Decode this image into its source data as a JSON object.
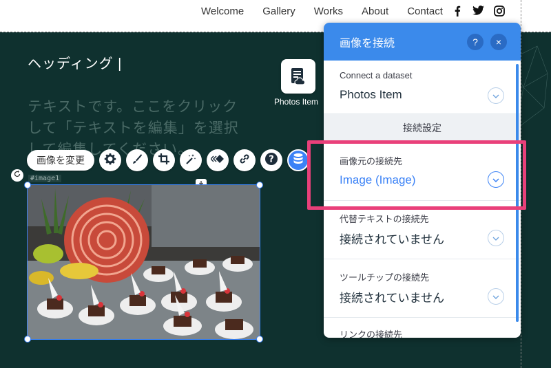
{
  "nav": {
    "links": [
      "Welcome",
      "Gallery",
      "Works",
      "About",
      "Contact"
    ],
    "social": [
      "facebook-icon",
      "twitter-icon",
      "instagram-icon"
    ]
  },
  "canvas": {
    "heading": "ヘッディング |",
    "body_lines": [
      "テキストです。ここをクリック",
      "して「テキストを編集」を選択",
      "して編集してください。"
    ],
    "dataset_label": "Photos Item",
    "image_id": "#image1"
  },
  "toolbar": {
    "change_image": "画像を変更",
    "icons": [
      "gear-icon",
      "brush-icon",
      "crop-icon",
      "magic-wand-icon",
      "animation-icon",
      "link-icon",
      "help-icon",
      "database-icon"
    ]
  },
  "panel": {
    "title": "画像を接続",
    "help": "?",
    "close": "×",
    "dataset_label": "Connect a dataset",
    "dataset_value": "Photos Item",
    "settings_header": "接続設定",
    "image_source_label": "画像元の接続先",
    "image_source_value": "Image (Image)",
    "alt_label": "代替テキストの接続先",
    "alt_value": "接続されていません",
    "tooltip_label": "ツールチップの接続先",
    "tooltip_value": "接続されていません",
    "link_label": "リンクの接続先"
  },
  "colors": {
    "accent": "#3b8aeb",
    "highlight": "#e9407a",
    "canvas_bg": "#0f312f"
  }
}
